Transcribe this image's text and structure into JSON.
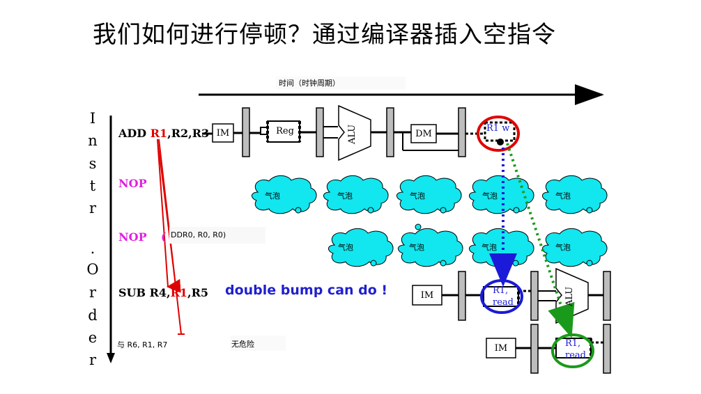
{
  "title": "我们如何进行停顿？通过编译器插入空指令",
  "time_label": "时间（时钟周期）",
  "order_axis_chars": [
    "I",
    "n",
    "s",
    "t",
    "r",
    ".",
    "O",
    "r",
    "d",
    "e",
    "r"
  ],
  "instructions": {
    "add_prefix": "ADD ",
    "add_reg": "R1",
    "add_rest": ",R2,R3",
    "nop1": "NOP",
    "nop2": "NOP",
    "nop2_mark": "(",
    "addr_text": "DDR0, R0, R0)",
    "sub_prefix": "SUB R4,",
    "sub_reg": "R1",
    "sub_rest": ",R5",
    "and_text": "与 R6, R1, R7"
  },
  "double_bump": "double bump can do !",
  "no_hazard": "无危险",
  "stages": {
    "im": "IM",
    "reg": "Reg",
    "alu": "ALU",
    "dm": "DM",
    "r1_write": "R1 w",
    "r1_read_top": "R1,",
    "r1_read_bottom": "read"
  },
  "bubble_label": "气泡",
  "colors": {
    "red": "#e00000",
    "blue": "#1a1ad8",
    "green": "#1a9a1a",
    "cyan": "#12e6ee",
    "nop": "#e020e0",
    "gray_bar": "#bdbdbd"
  }
}
